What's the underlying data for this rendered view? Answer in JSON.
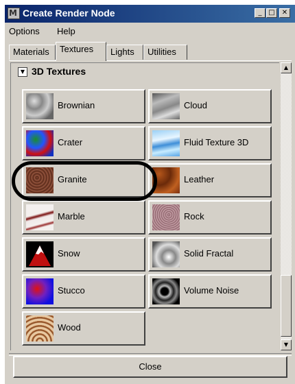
{
  "window": {
    "title": "Create Render Node",
    "minimize_glyph": "_",
    "maximize_glyph": "□",
    "close_glyph": "✕"
  },
  "menu": [
    "Options",
    "Help"
  ],
  "tabs": [
    {
      "label": "Materials",
      "active": false
    },
    {
      "label": "Textures",
      "active": true
    },
    {
      "label": "Lights",
      "active": false
    },
    {
      "label": "Utilities",
      "active": false
    }
  ],
  "section": {
    "title": "3D Textures",
    "collapse_glyph": "▼"
  },
  "nodes": [
    {
      "label": "Brownian",
      "swatch": "brownian-swatch-icon"
    },
    {
      "label": "Cloud",
      "swatch": "cloud-swatch-icon"
    },
    {
      "label": "Crater",
      "swatch": "crater-swatch-icon"
    },
    {
      "label": "Fluid Texture 3D",
      "swatch": "fluid-texture-swatch-icon"
    },
    {
      "label": "Granite",
      "swatch": "granite-swatch-icon"
    },
    {
      "label": "Leather",
      "swatch": "leather-swatch-icon"
    },
    {
      "label": "Marble",
      "swatch": "marble-swatch-icon"
    },
    {
      "label": "Rock",
      "swatch": "rock-swatch-icon"
    },
    {
      "label": "Snow",
      "swatch": "snow-swatch-icon"
    },
    {
      "label": "Solid Fractal",
      "swatch": "solid-fractal-swatch-icon"
    },
    {
      "label": "Stucco",
      "swatch": "stucco-swatch-icon"
    },
    {
      "label": "Volume Noise",
      "swatch": "volume-noise-swatch-icon"
    },
    {
      "label": "Wood",
      "swatch": "wood-swatch-icon"
    }
  ],
  "scrollbar": {
    "up_glyph": "▲",
    "down_glyph": "▼"
  },
  "footer": {
    "close_label": "Close"
  },
  "colors": {
    "title_bar": "#0a246a",
    "face": "#d4d0c8",
    "annotation": "#000000"
  }
}
